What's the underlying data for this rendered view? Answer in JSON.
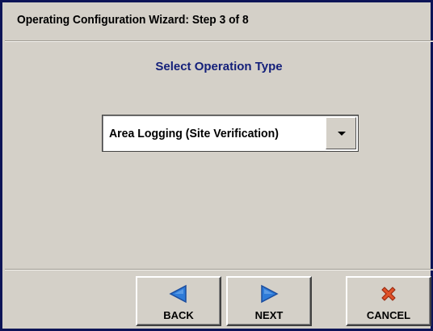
{
  "window": {
    "title": "Operating Configuration Wizard:  Step 3 of 8"
  },
  "main": {
    "heading": "Select Operation Type",
    "operation_select": {
      "selected_value": "Area Logging (Site Verification)"
    }
  },
  "footer": {
    "back_label": "BACK",
    "next_label": "NEXT",
    "cancel_label": "CANCEL"
  },
  "icons": {
    "back": "triangle-left-icon",
    "next": "triangle-right-icon",
    "cancel": "red-x-icon",
    "dropdown": "chevron-down-icon"
  },
  "colors": {
    "frame": "#0d1457",
    "panel": "#d4d0c8",
    "heading": "#14207a",
    "arrow_fill": "#2e7bd8",
    "cancel_x": "#e0522a"
  }
}
